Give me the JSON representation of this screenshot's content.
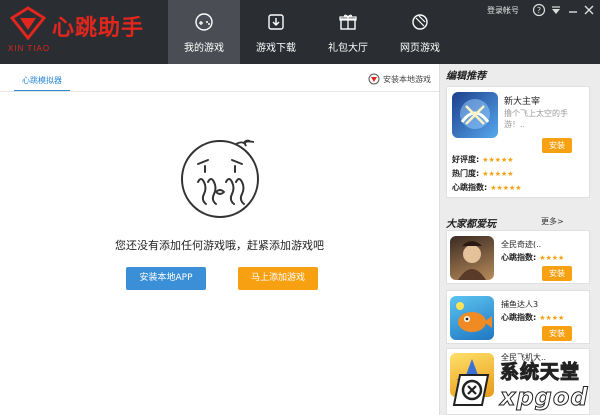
{
  "app": {
    "logo_text": "心跳助手",
    "logo_sub": "XIN TIAO",
    "brand_color": "#e1261d"
  },
  "nav": [
    {
      "label": "我的游戏",
      "icon": "gamepad-icon",
      "active": true
    },
    {
      "label": "游戏下载",
      "icon": "download-icon",
      "active": false
    },
    {
      "label": "礼包大厅",
      "icon": "gift-icon",
      "active": false
    },
    {
      "label": "网页游戏",
      "icon": "browser-game-icon",
      "active": false
    }
  ],
  "window": {
    "account_label": "登录帐号",
    "controls": [
      "help-icon",
      "menu-icon",
      "minimize-icon",
      "close-icon"
    ]
  },
  "main": {
    "tab_label": "心跳模拟器",
    "install_local_label": "安装本地游戏",
    "empty_message": "您还没有添加任何游戏哦，赶紧添加游戏吧",
    "install_app_button": "安装本地APP",
    "add_game_button": "马上添加游戏"
  },
  "sidebar": {
    "featured_title": "编辑推荐",
    "featured": {
      "name": "新大主宰",
      "desc": "撸个飞上太空的手游！..",
      "install_label": "安装",
      "ratings": [
        {
          "label": "好评度:",
          "stars": "★★★★★"
        },
        {
          "label": "热门度:",
          "stars": "★★★★★"
        },
        {
          "label": "心跳指数:",
          "stars": "★★★★★"
        }
      ]
    },
    "popular_title": "大家都爱玩",
    "more_label": "更多>",
    "popular": [
      {
        "name": "全民奇迹(..",
        "rate_label": "心跳指数:",
        "stars": "★★★★",
        "install_label": "安装"
      },
      {
        "name": "捕鱼达人3",
        "rate_label": "心跳指数:",
        "stars": "★★★★",
        "install_label": "安装"
      },
      {
        "name": "全民飞机大..",
        "rate_label": "",
        "stars": "",
        "install_label": ""
      }
    ]
  },
  "watermark": {
    "line1": "系统天堂",
    "line2": "xpgod"
  },
  "colors": {
    "header_bg": "#2a2d31",
    "accent_blue": "#3a8fd6",
    "accent_orange": "#f6a012"
  }
}
